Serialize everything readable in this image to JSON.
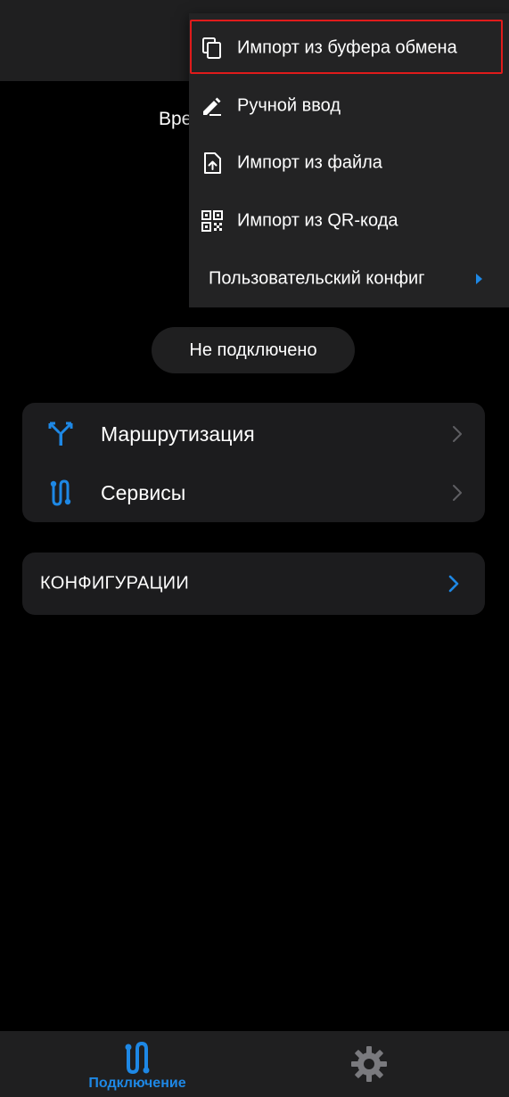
{
  "colors": {
    "accent": "#1e88e5",
    "background": "#000000",
    "surface": "#1c1c1e",
    "menu": "#232324",
    "highlight": "#e01b1b"
  },
  "header": {
    "partial_text": "Вре"
  },
  "status": {
    "text": "Не подключено"
  },
  "nav": {
    "items": [
      {
        "label": "Маршрутизация",
        "icon": "routing-icon"
      },
      {
        "label": "Сервисы",
        "icon": "services-icon"
      }
    ]
  },
  "configs": {
    "label": "КОНФИГУРАЦИИ"
  },
  "menu": {
    "items": [
      {
        "label": "Импорт из буфера обмена",
        "icon": "copy-icon"
      },
      {
        "label": "Ручной ввод",
        "icon": "pencil-icon"
      },
      {
        "label": "Импорт из файла",
        "icon": "file-upload-icon"
      },
      {
        "label": "Импорт из QR-кода",
        "icon": "qr-code-icon"
      },
      {
        "label": "Пользовательский конфиг",
        "icon": "submenu-arrow-icon"
      }
    ]
  },
  "bottom_nav": {
    "tabs": [
      {
        "label": "Подключение",
        "icon": "connection-icon",
        "active": true
      },
      {
        "label": "",
        "icon": "gear-icon",
        "active": false
      }
    ]
  }
}
